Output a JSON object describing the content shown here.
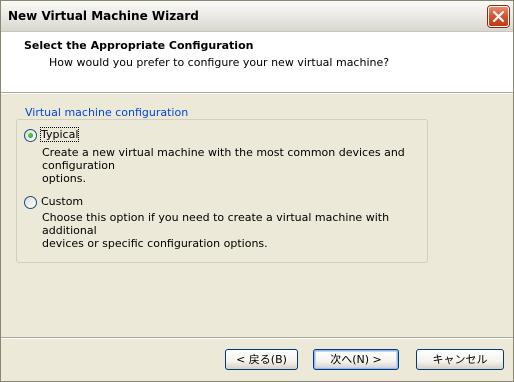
{
  "window": {
    "title": "New Virtual Machine Wizard"
  },
  "header": {
    "title": "Select the Appropriate Configuration",
    "subtitle": "How would you prefer to configure your new virtual machine?"
  },
  "group": {
    "legend": "Virtual machine configuration",
    "options": [
      {
        "label": "Typical",
        "selected": true,
        "description_lines": [
          "Create a new virtual machine with the most common devices and configuration",
          "options."
        ]
      },
      {
        "label": "Custom",
        "selected": false,
        "description_lines": [
          "Choose this option if you need to create a virtual machine with additional",
          "devices or specific configuration options."
        ]
      }
    ]
  },
  "buttons": {
    "back": "< 戻る(B)",
    "next": "次へ(N) >",
    "cancel": "キャンセル"
  },
  "icons": {
    "close": "close-icon"
  },
  "colors": {
    "legend": "#0046d5",
    "close_button": "#d4512d",
    "radio_selected": "#21a121"
  }
}
